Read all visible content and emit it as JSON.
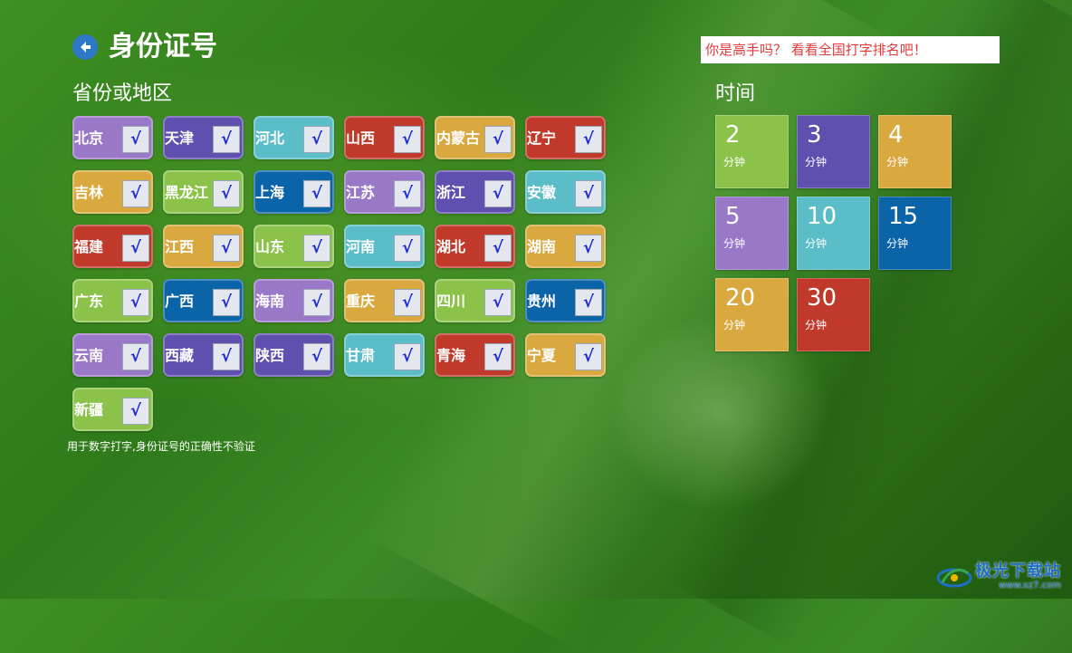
{
  "header": {
    "title": "身份证号",
    "back_icon": "back-arrow-icon"
  },
  "rank_link": "你是高手吗？ 看看全国打字排名吧！",
  "provinces": {
    "heading": "省份或地区",
    "check_mark": "√",
    "items": [
      {
        "name": "北京",
        "color": "#9a78c8",
        "checked": true
      },
      {
        "name": "天津",
        "color": "#5f4fae",
        "checked": true
      },
      {
        "name": "河北",
        "color": "#5bbdc8",
        "checked": true
      },
      {
        "name": "山西",
        "color": "#c0392b",
        "checked": true
      },
      {
        "name": "内蒙古",
        "color": "#d9a940",
        "checked": true
      },
      {
        "name": "辽宁",
        "color": "#c0392b",
        "checked": true
      },
      {
        "name": "吉林",
        "color": "#d9a940",
        "checked": true
      },
      {
        "name": "黑龙江",
        "color": "#8bc34a",
        "checked": true
      },
      {
        "name": "上海",
        "color": "#0b63a8",
        "checked": true
      },
      {
        "name": "江苏",
        "color": "#9a78c8",
        "checked": true
      },
      {
        "name": "浙江",
        "color": "#5f4fae",
        "checked": true
      },
      {
        "name": "安徽",
        "color": "#5bbdc8",
        "checked": true
      },
      {
        "name": "福建",
        "color": "#c0392b",
        "checked": true
      },
      {
        "name": "江西",
        "color": "#d9a940",
        "checked": true
      },
      {
        "name": "山东",
        "color": "#8bc34a",
        "checked": true
      },
      {
        "name": "河南",
        "color": "#5bbdc8",
        "checked": true
      },
      {
        "name": "湖北",
        "color": "#c0392b",
        "checked": true
      },
      {
        "name": "湖南",
        "color": "#d9a940",
        "checked": true
      },
      {
        "name": "广东",
        "color": "#8bc34a",
        "checked": true
      },
      {
        "name": "广西",
        "color": "#0b63a8",
        "checked": true
      },
      {
        "name": "海南",
        "color": "#9a78c8",
        "checked": true
      },
      {
        "name": "重庆",
        "color": "#d9a940",
        "checked": true
      },
      {
        "name": "四川",
        "color": "#8bc34a",
        "checked": true
      },
      {
        "name": "贵州",
        "color": "#0b63a8",
        "checked": true
      },
      {
        "name": "云南",
        "color": "#9a78c8",
        "checked": true
      },
      {
        "name": "西藏",
        "color": "#5f4fae",
        "checked": true
      },
      {
        "name": "陕西",
        "color": "#5f4fae",
        "checked": true
      },
      {
        "name": "甘肃",
        "color": "#5bbdc8",
        "checked": true
      },
      {
        "name": "青海",
        "color": "#c0392b",
        "checked": true
      },
      {
        "name": "宁夏",
        "color": "#d9a940",
        "checked": true
      },
      {
        "name": "新疆",
        "color": "#8bc34a",
        "checked": true
      }
    ]
  },
  "note": "用于数字打字,身份证号的正确性不验证",
  "time": {
    "heading": "时间",
    "unit": "分钟",
    "options": [
      {
        "minutes": "2",
        "color": "#8bc34a"
      },
      {
        "minutes": "3",
        "color": "#5f4fae"
      },
      {
        "minutes": "4",
        "color": "#d9a940"
      },
      {
        "minutes": "5",
        "color": "#9a78c8"
      },
      {
        "minutes": "10",
        "color": "#5bbdc8"
      },
      {
        "minutes": "15",
        "color": "#0b63a8"
      },
      {
        "minutes": "20",
        "color": "#d9a940"
      },
      {
        "minutes": "30",
        "color": "#c0392b"
      }
    ]
  },
  "watermark": {
    "name": "极光下载站",
    "url": "www.xz7.com"
  }
}
